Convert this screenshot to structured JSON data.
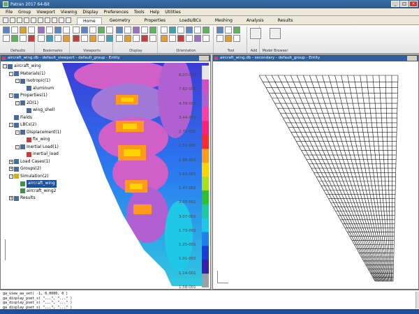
{
  "window": {
    "title": "Patran 2017 64-Bit"
  },
  "menu": [
    "File",
    "Group",
    "Viewport",
    "Viewing",
    "Display",
    "Preferences",
    "Tools",
    "Help",
    "Utilities"
  ],
  "ribbon_tabs": [
    {
      "label": "Home",
      "active": true
    },
    {
      "label": "Geometry",
      "active": false
    },
    {
      "label": "Properties",
      "active": false
    },
    {
      "label": "Loads/BCs",
      "active": false
    },
    {
      "label": "Meshing",
      "active": false
    },
    {
      "label": "Analysis",
      "active": false
    },
    {
      "label": "Results",
      "active": false
    }
  ],
  "ribbon_groups": [
    "Defaults",
    "Bookmarks",
    "Viewports",
    "Display",
    "Orientation",
    "Tool",
    "Add",
    "Model Browser"
  ],
  "viewports": {
    "left": {
      "title": "aircraft_wing.db - default_viewport - default_group - Entity"
    },
    "right": {
      "title": "aircraft_wing.db - secondary - default_group - Entity"
    }
  },
  "tree": [
    {
      "label": "aircraft_wing",
      "level": 0,
      "expander": "-",
      "icon": "db-icon"
    },
    {
      "label": "Materials(1)",
      "level": 1,
      "expander": "-",
      "icon": "materials-icon"
    },
    {
      "label": "Isotropic(1)",
      "level": 2,
      "expander": "-",
      "icon": "isotropic-icon"
    },
    {
      "label": "aluminum",
      "level": 3,
      "expander": "",
      "icon": "material-icon"
    },
    {
      "label": "Properties(1)",
      "level": 1,
      "expander": "-",
      "icon": "properties-icon"
    },
    {
      "label": "2D(1)",
      "level": 2,
      "expander": "-",
      "icon": "property-2d-icon"
    },
    {
      "label": "wing_shell",
      "level": 3,
      "expander": "",
      "icon": "shell-icon"
    },
    {
      "label": "Fields",
      "level": 1,
      "expander": "",
      "icon": "fields-icon"
    },
    {
      "label": "LBCs(2)",
      "level": 1,
      "expander": "-",
      "icon": "lbcs-icon"
    },
    {
      "label": "Displacement(1)",
      "level": 2,
      "expander": "-",
      "icon": "displacement-icon"
    },
    {
      "label": "fix_wing",
      "level": 3,
      "expander": "",
      "icon": "constraint-icon"
    },
    {
      "label": "Inertial Load(1)",
      "level": 2,
      "expander": "-",
      "icon": "inertial-icon"
    },
    {
      "label": "inertial_load",
      "level": 3,
      "expander": "",
      "icon": "load-icon"
    },
    {
      "label": "Load Cases(1)",
      "level": 1,
      "expander": "+",
      "icon": "loadcases-icon"
    },
    {
      "label": "Groups(2)",
      "level": 1,
      "expander": "+",
      "icon": "groups-icon"
    },
    {
      "label": "Simulation(2)",
      "level": 1,
      "expander": "-",
      "icon": "simulation-icon"
    },
    {
      "label": "aircraft_wing",
      "level": 2,
      "expander": "",
      "icon": "job-icon",
      "selected": true
    },
    {
      "label": "aircraft_wing2",
      "level": 2,
      "expander": "",
      "icon": "job-icon"
    },
    {
      "label": "Results",
      "level": 1,
      "expander": "+",
      "icon": "results-icon"
    }
  ],
  "legend": {
    "labels": [
      "8.07-001",
      "7.82-002",
      "4.78-002",
      "3.44-002",
      "2.75-002",
      "2.51-002",
      "1.86-001",
      "1.55-001",
      "1.47-002",
      "3.07-002",
      "3.07-001",
      "1.73-001",
      "1.25-001",
      "1.01-002",
      "1.14-001",
      "1.58-001"
    ],
    "colors": [
      "#e6e6e6",
      "#d050c0",
      "#b060d0",
      "#ff40a0",
      "#ff2070",
      "#ff2a2a",
      "#ff9a1a",
      "#ffd400",
      "#a8e020",
      "#30c030",
      "#20c8a0",
      "#20c8e8",
      "#2080f0",
      "#1a3cd8",
      "#3a20a8",
      "#9aa0a8"
    ]
  },
  "output": {
    "lines": [
      "ga_view_aa_set( -1, 0.0000, 0 )",
      "ga_display_pset_s( \"...\", \"...\" )",
      "ga_display_pset_s( \"...\", \"...\" )",
      "ga_display_pset_s( \"...\", \"...\" )"
    ]
  }
}
